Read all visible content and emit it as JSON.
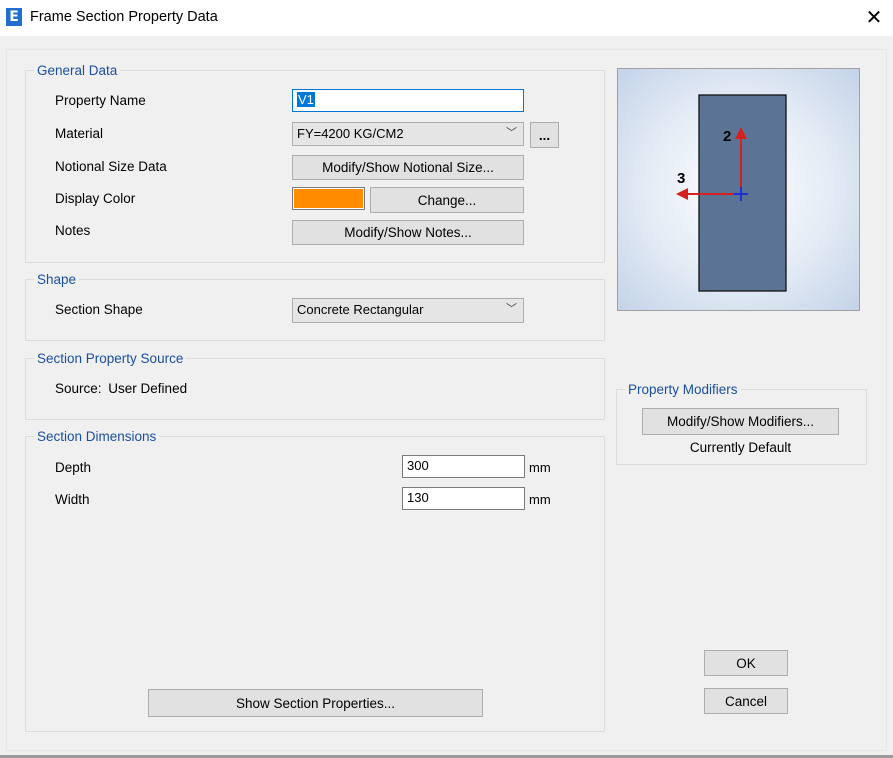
{
  "window": {
    "title": "Frame Section Property Data",
    "app_icon_letter": "E",
    "close_glyph": "✕"
  },
  "general": {
    "legend": "General Data",
    "property_name_label": "Property Name",
    "property_name_value": "V1",
    "material_label": "Material",
    "material_value": "FY=4200  KG/CM2",
    "material_more": "...",
    "notional_label": "Notional Size Data",
    "notional_button": "Modify/Show Notional Size...",
    "display_color_label": "Display Color",
    "display_color": "#ff8c00",
    "change_button": "Change...",
    "notes_label": "Notes",
    "notes_button": "Modify/Show Notes..."
  },
  "shape": {
    "legend": "Shape",
    "section_shape_label": "Section Shape",
    "section_shape_value": "Concrete Rectangular"
  },
  "source": {
    "legend": "Section Property Source",
    "source_label": "Source:",
    "source_value": "User Defined"
  },
  "dimensions": {
    "legend": "Section Dimensions",
    "depth_label": "Depth",
    "depth_value": "300",
    "depth_unit": "mm",
    "width_label": "Width",
    "width_value": "130",
    "width_unit": "mm"
  },
  "preview": {
    "axis2_label": "2",
    "axis3_label": "3",
    "section_fill": "#5b7495",
    "arrow_color": "#d62020",
    "centroid_color": "#1a33d6"
  },
  "modifiers": {
    "legend": "Property Modifiers",
    "button": "Modify/Show Modifiers...",
    "status": "Currently Default"
  },
  "actions": {
    "show_section_properties": "Show Section Properties...",
    "ok": "OK",
    "cancel": "Cancel"
  }
}
